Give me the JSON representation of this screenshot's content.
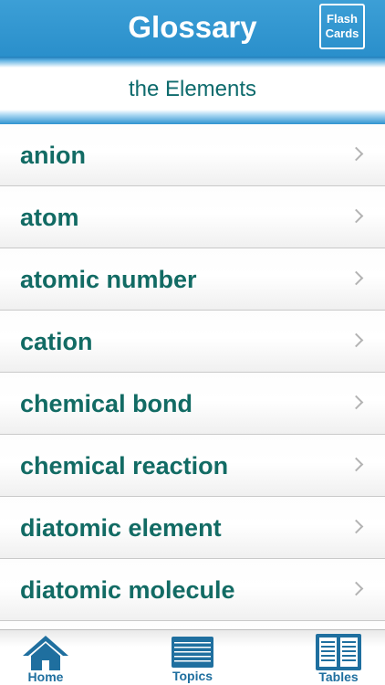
{
  "header": {
    "title": "Glossary",
    "flash_line1": "Flash",
    "flash_line2": "Cards"
  },
  "subheader": {
    "title": "the Elements"
  },
  "list": {
    "items": [
      "anion",
      "atom",
      "atomic number",
      "cation",
      "chemical bond",
      "chemical reaction",
      "diatomic element",
      "diatomic molecule",
      ""
    ]
  },
  "tabs": {
    "home": "Home",
    "topics": "Topics",
    "tables": "Tables"
  },
  "colors": {
    "header_blue": "#2a8fcb",
    "text_teal": "#126b64",
    "tab_icon_blue": "#1f6f9f"
  },
  "icons": {
    "home": "home-icon",
    "topics": "list-icon",
    "tables": "book-icon",
    "row": "chevron-right-icon"
  }
}
